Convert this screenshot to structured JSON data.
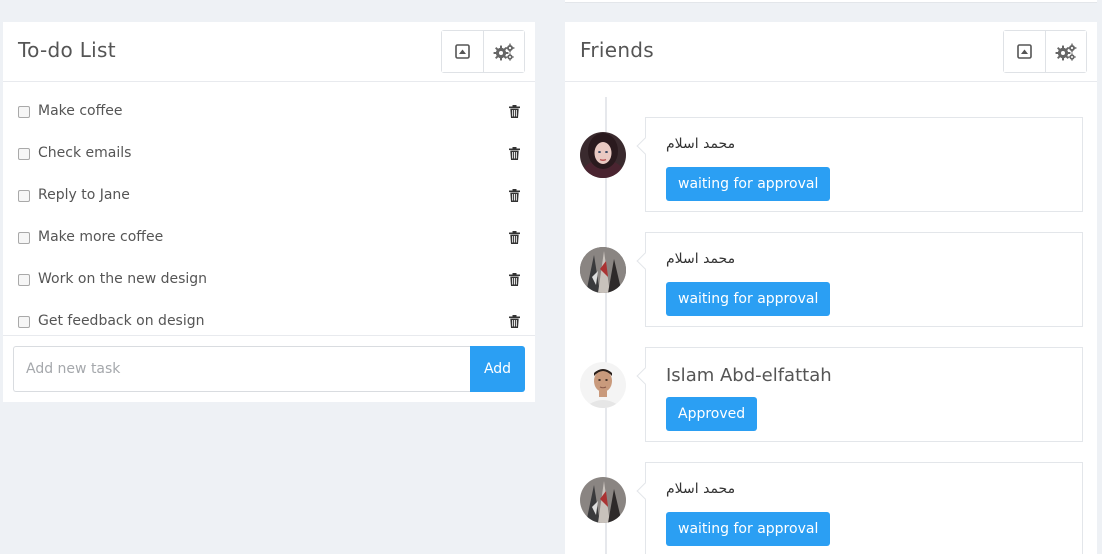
{
  "todo": {
    "title": "To-do List",
    "tools": {
      "collapse_icon": "collapse-icon",
      "settings_icon": "gears-icon"
    },
    "items": [
      {
        "text": "Make coffee",
        "checked": false
      },
      {
        "text": "Check emails",
        "checked": false
      },
      {
        "text": "Reply to Jane",
        "checked": false
      },
      {
        "text": "Make more coffee",
        "checked": false
      },
      {
        "text": "Work on the new design",
        "checked": false
      },
      {
        "text": "Get feedback on design",
        "checked": false
      }
    ],
    "input": {
      "placeholder": "Add new task",
      "value": ""
    },
    "add_label": "Add"
  },
  "friends": {
    "title": "Friends",
    "items": [
      {
        "name": "محمد اسلام",
        "status": "waiting for approval"
      },
      {
        "name": "محمد اسلام",
        "status": "waiting for approval"
      },
      {
        "name": "Islam Abd-elfattah",
        "status": "Approved"
      },
      {
        "name": "محمد اسلام",
        "status": "waiting for approval"
      }
    ]
  },
  "colors": {
    "accent": "#2b9ff3",
    "background": "#eef1f5"
  }
}
